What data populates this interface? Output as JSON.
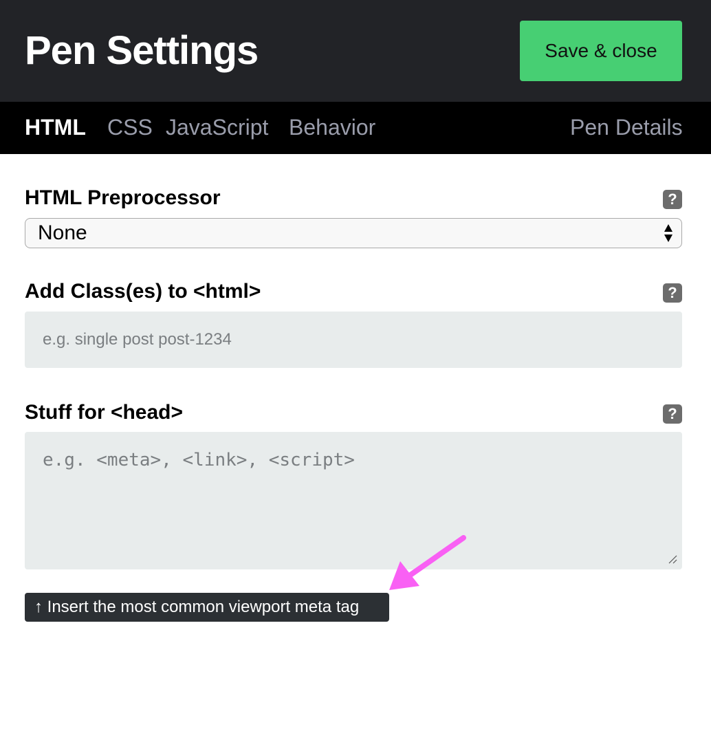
{
  "header": {
    "title": "Pen Settings",
    "save_label": "Save & close"
  },
  "tabs": [
    {
      "label": "HTML",
      "active": true
    },
    {
      "label": "CSS",
      "active": false
    },
    {
      "label": "JavaScript",
      "active": false
    },
    {
      "label": "Behavior",
      "active": false
    },
    {
      "label": "Pen Details",
      "active": false
    }
  ],
  "fields": {
    "preprocessor": {
      "label": "HTML Preprocessor",
      "selected": "None"
    },
    "html_classes": {
      "label": "Add Class(es) to <html>",
      "placeholder": "e.g. single post post-1234"
    },
    "head_stuff": {
      "label": "Stuff for <head>",
      "placeholder": "e.g. <meta>, <link>, <script>"
    }
  },
  "meta_button_label": "↑ Insert the most common viewport meta tag",
  "help_icon_text": "?",
  "colors": {
    "header_bg": "#222327",
    "tabs_bg": "#000000",
    "save_button": "#47cf73",
    "annotation_arrow": "#f960f4"
  },
  "icons": {
    "help": "question-mark-icon",
    "select_arrows": "up-down-arrows-icon",
    "resize": "resize-handle-icon",
    "annotation": "pink-arrow-annotation"
  }
}
